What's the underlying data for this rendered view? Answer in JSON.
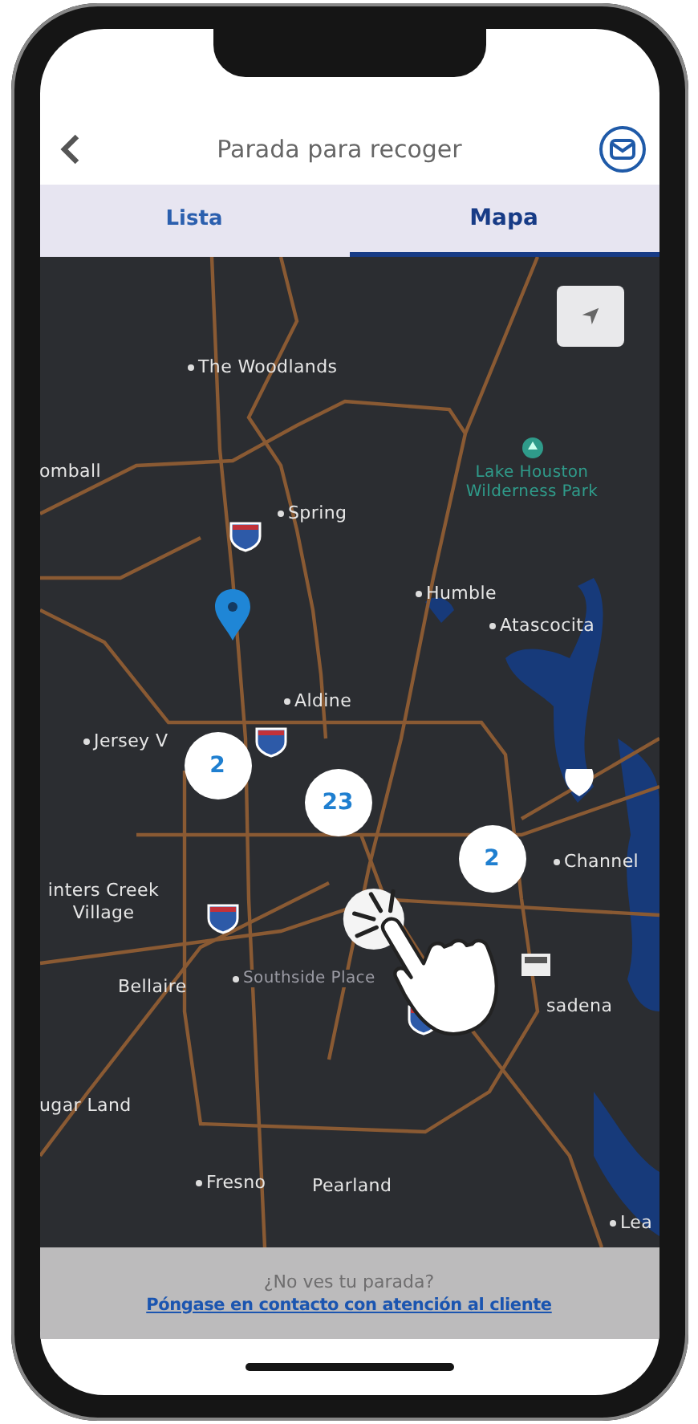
{
  "header": {
    "title": "Parada para recoger"
  },
  "tabs": [
    {
      "label": "Lista",
      "selected": false
    },
    {
      "label": "Mapa",
      "selected": true
    }
  ],
  "map": {
    "places": [
      {
        "label": "The Woodlands",
        "kind": "city"
      },
      {
        "label": "omball",
        "kind": "city"
      },
      {
        "label": "Lake Houston Wilderness Park",
        "kind": "park"
      },
      {
        "label": "Spring",
        "kind": "city"
      },
      {
        "label": "Humble",
        "kind": "city"
      },
      {
        "label": "Atascocita",
        "kind": "city"
      },
      {
        "label": "Aldine",
        "kind": "city"
      },
      {
        "label": "Jersey V",
        "kind": "city"
      },
      {
        "label": "Channel",
        "kind": "city"
      },
      {
        "label": "inters Creek Village",
        "kind": "city"
      },
      {
        "label": "Bellaire",
        "kind": "city"
      },
      {
        "label": "Southside Place",
        "kind": "district"
      },
      {
        "label": "sadena",
        "kind": "city"
      },
      {
        "label": "ugar Land",
        "kind": "city"
      },
      {
        "label": "Fresno",
        "kind": "city"
      },
      {
        "label": "Pearland",
        "kind": "city"
      },
      {
        "label": "Lea",
        "kind": "city"
      }
    ],
    "clusters": [
      {
        "count": "2"
      },
      {
        "count": "23"
      },
      {
        "count": "2"
      }
    ]
  },
  "footer": {
    "prompt": "¿No ves tu parada?",
    "link": "Póngase en contacto con atención al cliente"
  }
}
